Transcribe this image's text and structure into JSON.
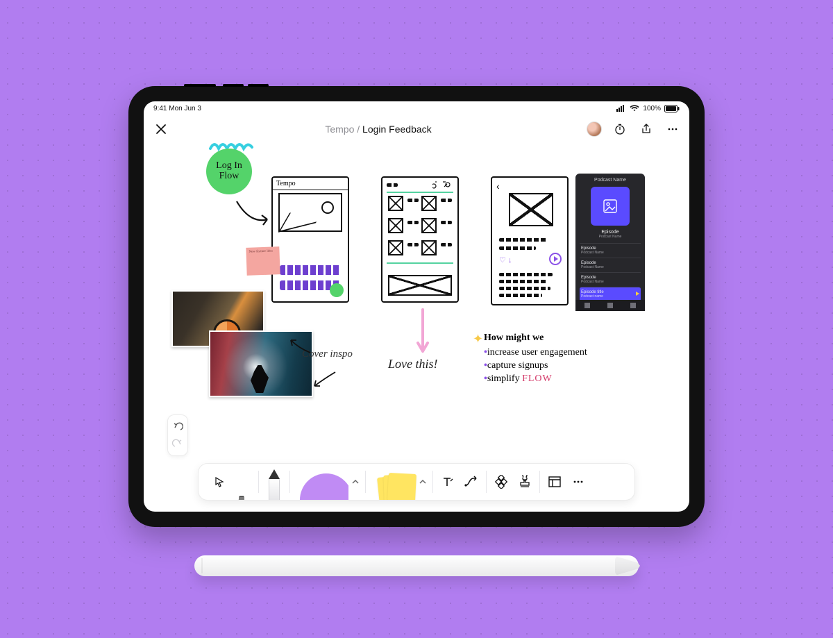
{
  "statusbar": {
    "time_date": "9:41  Mon Jun 3",
    "battery": "100%"
  },
  "nav": {
    "breadcrumb_parent": "Tempo",
    "separator": "/",
    "breadcrumb_current": "Login Feedback"
  },
  "canvas": {
    "login_badge": "Log In\nFlow",
    "wf1_title": "Tempo",
    "sticky_note": "New feature idea",
    "cover_inspo": "Cover inspo",
    "love_this": "Love this!",
    "hmw": {
      "title": "How might we",
      "items": [
        "increase user engagement",
        "capture signups",
        "simplify "
      ],
      "flow_word": "FLOW"
    },
    "podcast": {
      "header": "Podcast Name",
      "episode_title": "Episode",
      "episode_sub": "Podcast Name",
      "rows": [
        {
          "l1": "Episode",
          "l2": "Podcast Name"
        },
        {
          "l1": "Episode",
          "l2": "Podcast Name"
        },
        {
          "l1": "Episode",
          "l2": "Podcast Name"
        },
        {
          "l1": "Episode title",
          "l2": "Podcast name"
        }
      ]
    }
  },
  "toolbar": {
    "icons": {
      "pointer": "pointer",
      "hand": "hand",
      "pencil": "pencil",
      "shape": "shape",
      "sticky": "sticky",
      "text": "text",
      "connector": "connector",
      "widgets": "widgets",
      "stamp": "stamp",
      "layout": "layout",
      "more": "more"
    }
  }
}
